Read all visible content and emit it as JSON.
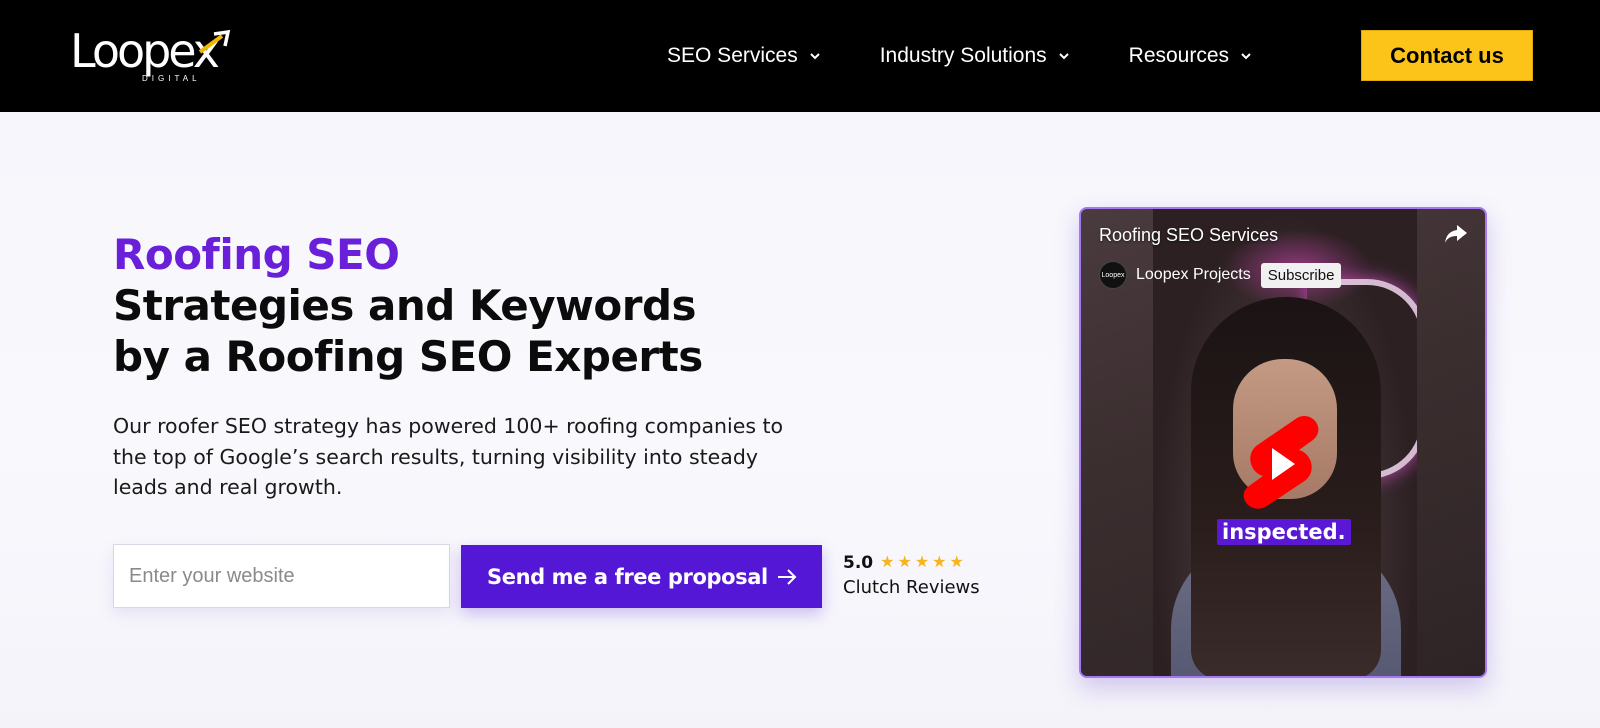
{
  "header": {
    "logo_text": "Loopex",
    "logo_sub": "DIGITAL",
    "nav": [
      {
        "label": "SEO Services"
      },
      {
        "label": "Industry Solutions"
      },
      {
        "label": "Resources"
      }
    ],
    "contact_label": "Contact us",
    "contact_color": "#fcc419"
  },
  "hero": {
    "title_accent": "Roofing SEO",
    "title_line1": "Strategies and Keywords",
    "title_line2": "by a Roofing SEO Experts",
    "description": "Our roofer SEO strategy has powered 100+ roofing companies to the top of Google’s search results, turning visibility into steady leads and real growth.",
    "accent_color": "#6a1fd8"
  },
  "form": {
    "website_placeholder": "Enter your website",
    "website_value": "",
    "submit_label": "Send me a free proposal",
    "submit_color": "#5417d6"
  },
  "rating": {
    "score": "5.0",
    "stars": 5,
    "source": "Clutch Reviews"
  },
  "video": {
    "title": "Roofing SEO Services",
    "channel": "Loopex Projects",
    "channel_avatar": "Loopex",
    "subscribe_label": "Subscribe",
    "caption": "inspected."
  }
}
